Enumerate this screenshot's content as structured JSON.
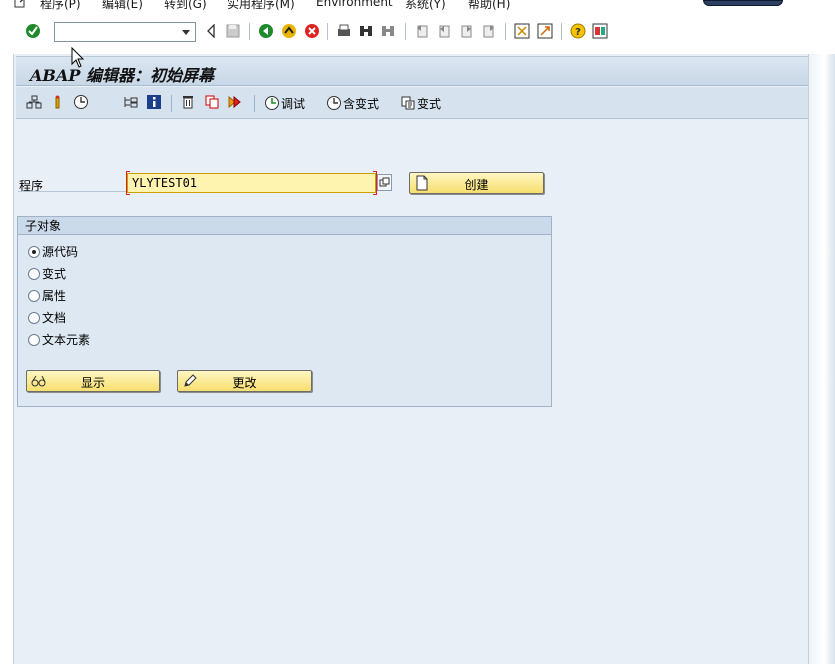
{
  "menubar": {
    "items": [
      "程序(P)",
      "编辑(E)",
      "转到(G)",
      "实用程序(M)",
      "Environment",
      "系统(Y)",
      "帮助(H)"
    ]
  },
  "std_toolbar": {
    "command_value": ""
  },
  "screen": {
    "title": "ABAP 编辑器：初始屏幕"
  },
  "app_toolbar": {
    "debug_label": "调试",
    "with_variant_label": "含变式",
    "variant_label": "变式"
  },
  "form": {
    "program_label": "程序",
    "program_value": "YLYTEST01",
    "create_button": "创建"
  },
  "subobjects": {
    "title": "子对象",
    "options": [
      "源代码",
      "变式",
      "属性",
      "文档",
      "文本元素"
    ],
    "selected_index": 0,
    "display_button": "显示",
    "change_button": "更改"
  },
  "colors": {
    "accent_green": "#1f8a2b",
    "field_required_bg": "#fff3b0",
    "button_yellow": "#f7df6e",
    "window_bg": "#e8eff6"
  }
}
